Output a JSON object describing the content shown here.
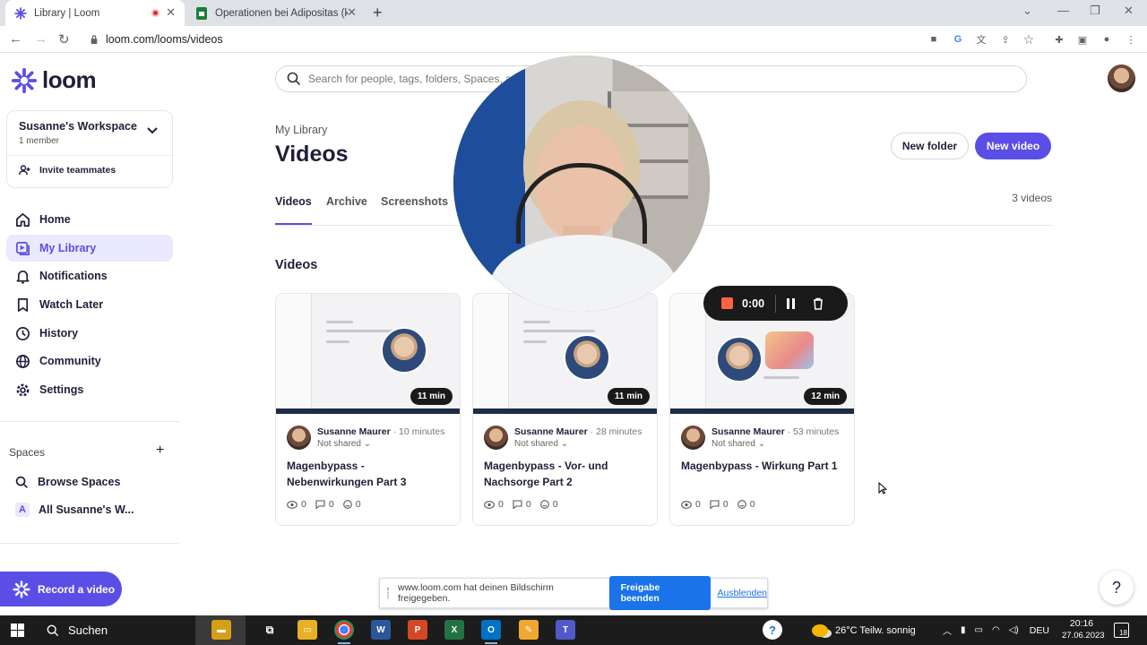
{
  "browser": {
    "tabs": [
      {
        "title": "Library | Loom"
      },
      {
        "title": "Operationen bei Adipositas (kran"
      }
    ],
    "url": "loom.com/looms/videos"
  },
  "sidebar": {
    "logo_text": "loom",
    "workspace": {
      "name": "Susanne's Workspace",
      "members": "1 member",
      "invite": "Invite teammates"
    },
    "nav": [
      {
        "label": "Home"
      },
      {
        "label": "My Library"
      },
      {
        "label": "Notifications"
      },
      {
        "label": "Watch Later"
      },
      {
        "label": "History"
      },
      {
        "label": "Community"
      },
      {
        "label": "Settings"
      }
    ],
    "spaces_heading": "Spaces",
    "spaces": [
      {
        "label": "Browse Spaces"
      },
      {
        "label": "All Susanne's W...",
        "badge": "A"
      }
    ],
    "record_button": "Record a video"
  },
  "search": {
    "placeholder": "Search for people, tags, folders, Spaces, an"
  },
  "main": {
    "breadcrumb": "My Library",
    "title": "Videos",
    "new_folder": "New folder",
    "new_video": "New video",
    "tabs": [
      {
        "label": "Videos"
      },
      {
        "label": "Archive"
      },
      {
        "label": "Screenshots"
      }
    ],
    "count": "3 videos",
    "section_heading": "Videos"
  },
  "videos": [
    {
      "duration": "11 min",
      "author": "Susanne Maurer",
      "ago": "· 10 minutes",
      "shared": "Not shared",
      "title": "Magenbypass - Nebenwirkungen Part 3",
      "views": "0",
      "comments": "0",
      "reactions": "0"
    },
    {
      "duration": "11 min",
      "author": "Susanne Maurer",
      "ago": "· 28 minutes",
      "shared": "Not shared",
      "title": "Magenbypass - Vor- und Nachsorge Part 2",
      "views": "0",
      "comments": "0",
      "reactions": "0"
    },
    {
      "duration": "12 min",
      "author": "Susanne Maurer",
      "ago": "· 53 minutes",
      "shared": "Not shared",
      "title": "Magenbypass - Wirkung Part 1",
      "views": "0",
      "comments": "0",
      "reactions": "0"
    }
  ],
  "recorder": {
    "time": "0:00"
  },
  "share_bar": {
    "message": "www.loom.com hat deinen Bildschirm freigegeben.",
    "stop": "Freigabe beenden",
    "hide": "Ausblenden"
  },
  "help": "?",
  "taskbar": {
    "search": "Suchen",
    "weather": "26°C  Teilw. sonnig",
    "lang": "DEU",
    "time": "20:16",
    "date": "27.06.2023",
    "notif_count": "18"
  },
  "colors": {
    "accent": "#5b4ee6",
    "accent_light": "#ebe9fd",
    "record_red": "#ff623e",
    "chrome_blue": "#1a73e8"
  }
}
